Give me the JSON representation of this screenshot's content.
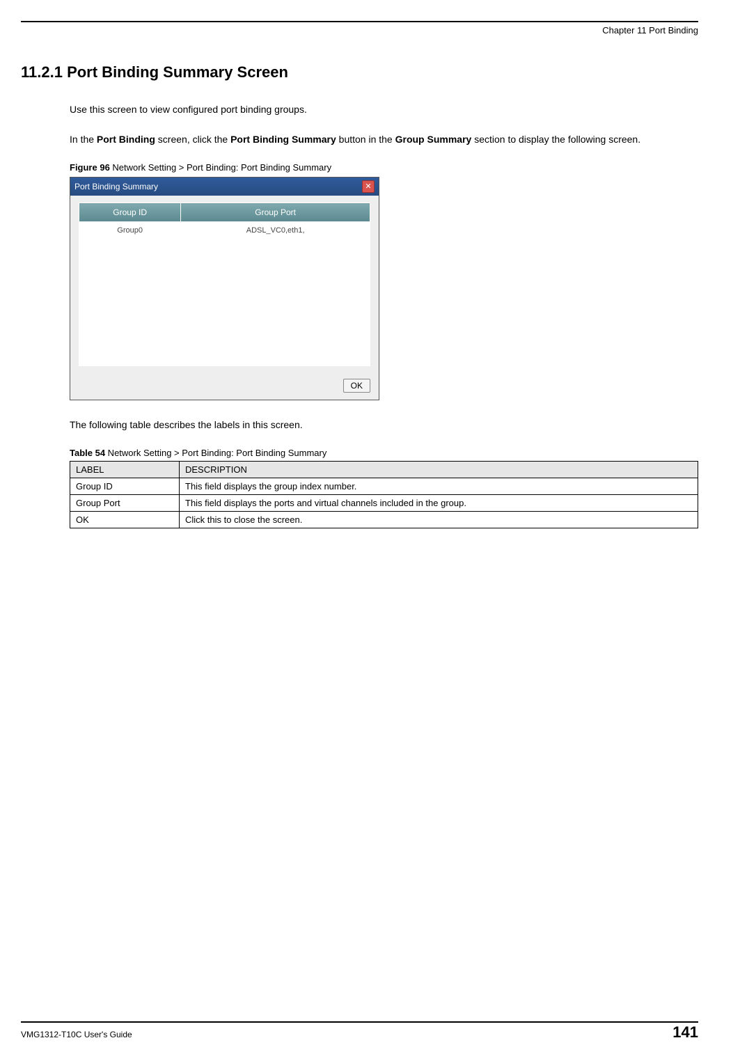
{
  "header": {
    "chapter": "Chapter 11 Port Binding"
  },
  "section": {
    "number": "11.2.1",
    "title_full": "11.2.1  Port Binding Summary Screen"
  },
  "paragraphs": {
    "p1": "Use this screen to view configured port binding groups.",
    "p2_a": "In the ",
    "p2_b": "Port Binding",
    "p2_c": " screen, click the ",
    "p2_d": "Port Binding Summary",
    "p2_e": " button in the ",
    "p2_f": "Group Summary",
    "p2_g": " section to display the following screen.",
    "p3": "The following table describes the labels in this screen."
  },
  "figure": {
    "label_prefix": "Figure 96",
    "label_text": "   Network Setting > Port Binding:  Port Binding Summary",
    "dialog_title": "Port Binding Summary",
    "columns": {
      "col1": "Group ID",
      "col2": "Group Port"
    },
    "row": {
      "c1": "Group0",
      "c2": "ADSL_VC0,eth1,"
    },
    "ok": "OK"
  },
  "table": {
    "label_prefix": "Table 54",
    "label_text": "   Network Setting > Port Binding:  Port Binding Summary",
    "headers": {
      "h1": "LABEL",
      "h2": "DESCRIPTION"
    },
    "rows": [
      {
        "label": "Group ID",
        "desc": "This field displays the group index number."
      },
      {
        "label": "Group Port",
        "desc": "This field displays the ports and virtual channels included in the group."
      },
      {
        "label": "OK",
        "desc": "Click this to close the screen."
      }
    ]
  },
  "footer": {
    "guide": "VMG1312-T10C User's Guide",
    "page": "141"
  }
}
